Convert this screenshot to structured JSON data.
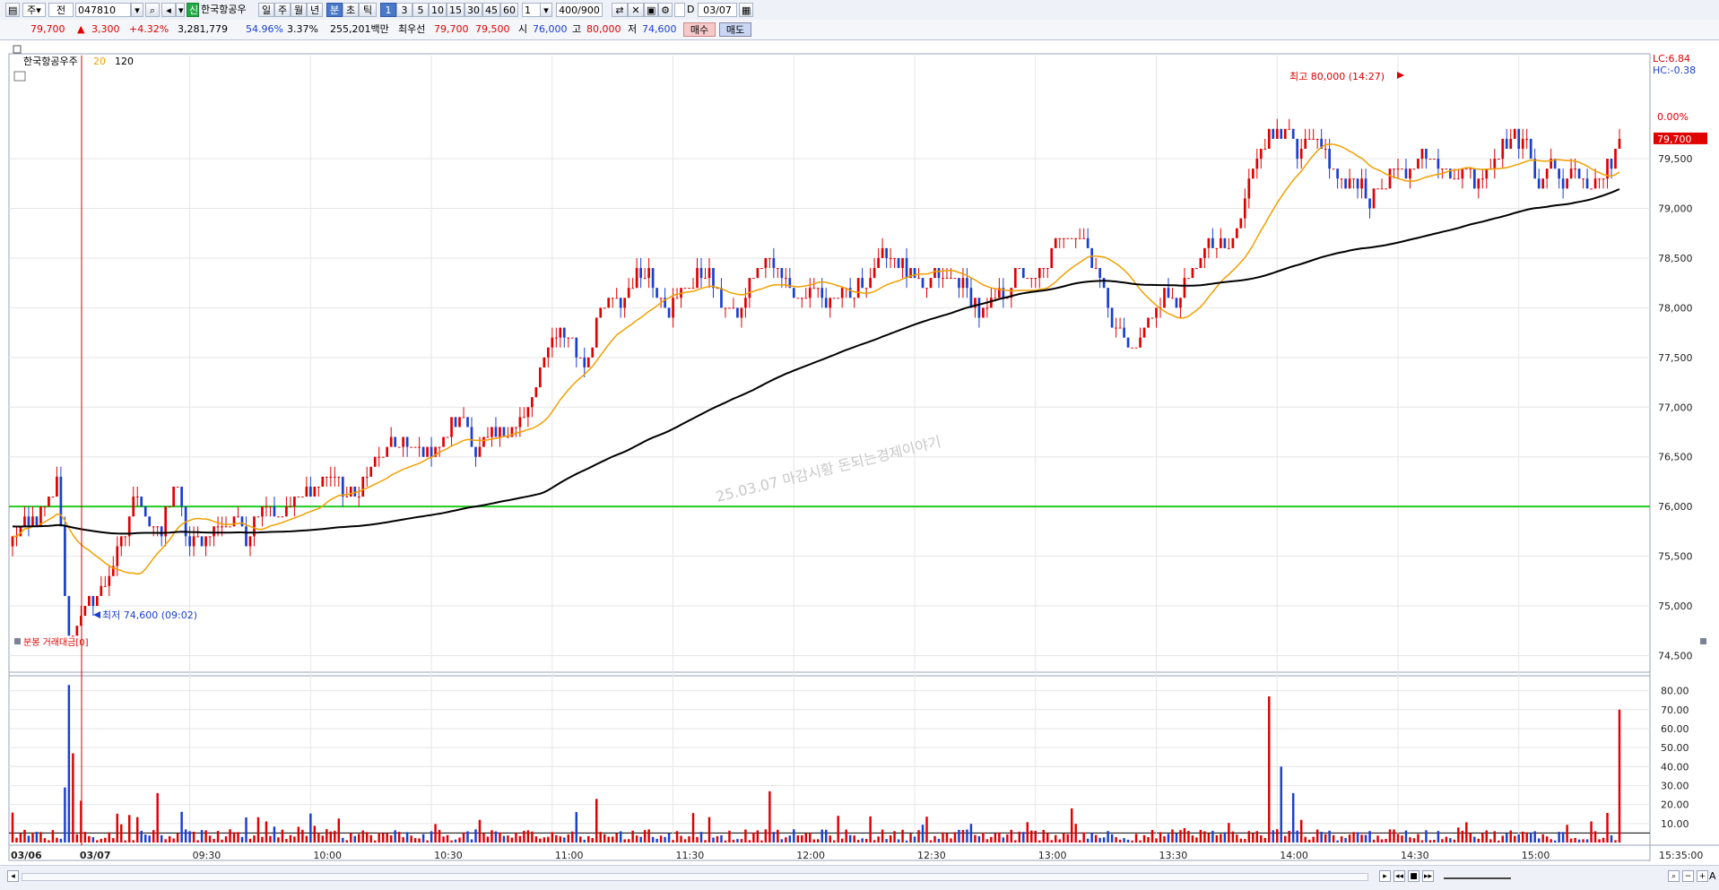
{
  "toolbar": {
    "market": "주",
    "scope": "전",
    "code": "047810",
    "name_tag": "신",
    "stock_name": "한국항공우",
    "periods": [
      "일",
      "주",
      "월",
      "년",
      "분",
      "초",
      "틱"
    ],
    "active_period": "분",
    "intervals": [
      "1",
      "3",
      "5",
      "10",
      "15",
      "30",
      "45",
      "60"
    ],
    "active_interval": "1",
    "count_select": "1",
    "range": "400/900",
    "d_label": "D",
    "date": "03/07"
  },
  "quote": {
    "price": "79,700",
    "arrow": "▲",
    "change": "3,300",
    "change_pct": "+4.32%",
    "volume": "3,281,779",
    "ratio1": "54.96%",
    "ratio2": "3.37%",
    "amount": "255,201백만",
    "best_label": "최우선",
    "best_ask": "79,700",
    "best_bid": "79,500",
    "open_label": "시",
    "open": "76,000",
    "high_label": "고",
    "high": "80,000",
    "low_label": "저",
    "low": "74,600",
    "buy_label": "매수",
    "sell_label": "매도"
  },
  "colors": {
    "up": "#e00000",
    "down": "#1a3fd0",
    "ma20": "#f0a000",
    "ma120": "#000000",
    "baseline": "#22cc22"
  },
  "chart_data": [
    {
      "type": "candlestick",
      "title": "한국항공우주",
      "legend": [
        {
          "name": "20",
          "color": "#f0a000"
        },
        {
          "name": "120",
          "color": "#000000"
        }
      ],
      "y_ticks": [
        "74,500",
        "75,000",
        "75,500",
        "76,000",
        "76,500",
        "77,000",
        "77,500",
        "78,000",
        "78,500",
        "79,000",
        "79,500"
      ],
      "ylim": [
        74450,
        80150
      ],
      "x_ticks": [
        "03/06",
        "03/07",
        "09:30",
        "10:00",
        "10:30",
        "11:00",
        "11:30",
        "12:00",
        "12:30",
        "13:00",
        "13:30",
        "14:00",
        "14:30",
        "15:00",
        "15:35:00"
      ],
      "last_price_label": "79,700",
      "last_pct_label": "0.00%",
      "lc_label": "LC:6.84",
      "hc_label": "HC:-0.38",
      "high_note": "최고 80,000 (14:27)",
      "low_note": "최저 74,600 (09:02)",
      "watermark": "25.03.07 마감시황 돈되는경제이야기",
      "baseline_value": 76000,
      "path": [
        [
          0,
          75650
        ],
        [
          6,
          75900
        ],
        [
          10,
          76050
        ],
        [
          11,
          76350
        ],
        [
          13,
          75100
        ],
        [
          14,
          74650
        ],
        [
          17,
          74900
        ],
        [
          20,
          75050
        ],
        [
          24,
          75300
        ],
        [
          27,
          75600
        ],
        [
          31,
          76150
        ],
        [
          34,
          75800
        ],
        [
          37,
          75750
        ],
        [
          40,
          76250
        ],
        [
          42,
          75950
        ],
        [
          44,
          75600
        ],
        [
          47,
          75650
        ],
        [
          50,
          75750
        ],
        [
          53,
          75850
        ],
        [
          56,
          75900
        ],
        [
          58,
          75600
        ],
        [
          60,
          75950
        ],
        [
          63,
          76050
        ],
        [
          66,
          75950
        ],
        [
          70,
          76050
        ],
        [
          73,
          76150
        ],
        [
          76,
          76200
        ],
        [
          79,
          76350
        ],
        [
          82,
          76150
        ],
        [
          85,
          76100
        ],
        [
          88,
          76300
        ],
        [
          91,
          76500
        ],
        [
          94,
          76600
        ],
        [
          97,
          76650
        ],
        [
          100,
          76550
        ],
        [
          103,
          76500
        ],
        [
          106,
          76650
        ],
        [
          109,
          76800
        ],
        [
          112,
          76950
        ],
        [
          115,
          76550
        ],
        [
          118,
          76700
        ],
        [
          121,
          76750
        ],
        [
          124,
          76800
        ],
        [
          127,
          76900
        ],
        [
          130,
          77150
        ],
        [
          133,
          77650
        ],
        [
          136,
          77800
        ],
        [
          139,
          77650
        ],
        [
          142,
          77400
        ],
        [
          145,
          77850
        ],
        [
          148,
          78050
        ],
        [
          151,
          78000
        ],
        [
          154,
          78300
        ],
        [
          157,
          78400
        ],
        [
          160,
          78200
        ],
        [
          163,
          78000
        ],
        [
          166,
          78150
        ],
        [
          169,
          78250
        ],
        [
          172,
          78400
        ],
        [
          175,
          78100
        ],
        [
          178,
          77950
        ],
        [
          181,
          78000
        ],
        [
          184,
          78300
        ],
        [
          187,
          78450
        ],
        [
          190,
          78400
        ],
        [
          193,
          78250
        ],
        [
          196,
          78100
        ],
        [
          199,
          78200
        ],
        [
          202,
          78050
        ],
        [
          205,
          78150
        ],
        [
          208,
          78100
        ],
        [
          211,
          78250
        ],
        [
          214,
          78400
        ],
        [
          217,
          78550
        ],
        [
          220,
          78450
        ],
        [
          223,
          78300
        ],
        [
          226,
          78200
        ],
        [
          229,
          78350
        ],
        [
          232,
          78250
        ],
        [
          235,
          78300
        ],
        [
          238,
          78100
        ],
        [
          241,
          77900
        ],
        [
          244,
          78050
        ],
        [
          247,
          78200
        ],
        [
          250,
          78350
        ],
        [
          253,
          78250
        ],
        [
          256,
          78400
        ],
        [
          259,
          78600
        ],
        [
          262,
          78800
        ],
        [
          265,
          78750
        ],
        [
          268,
          78500
        ],
        [
          271,
          78150
        ],
        [
          274,
          77800
        ],
        [
          277,
          77600
        ],
        [
          280,
          77700
        ],
        [
          283,
          77900
        ],
        [
          286,
          78150
        ],
        [
          289,
          78050
        ],
        [
          292,
          78300
        ],
        [
          295,
          78500
        ],
        [
          298,
          78650
        ],
        [
          301,
          78550
        ],
        [
          304,
          78750
        ],
        [
          307,
          79300
        ],
        [
          310,
          79650
        ],
        [
          313,
          79750
        ],
        [
          316,
          79850
        ],
        [
          319,
          79500
        ],
        [
          322,
          79700
        ],
        [
          325,
          79600
        ],
        [
          328,
          79400
        ],
        [
          331,
          79200
        ],
        [
          334,
          79300
        ],
        [
          337,
          79100
        ],
        [
          340,
          79250
        ],
        [
          343,
          79400
        ],
        [
          346,
          79300
        ],
        [
          349,
          79500
        ],
        [
          352,
          79550
        ],
        [
          355,
          79300
        ],
        [
          358,
          79400
        ],
        [
          361,
          79350
        ],
        [
          364,
          79300
        ],
        [
          367,
          79500
        ],
        [
          370,
          79600
        ],
        [
          373,
          79700
        ],
        [
          376,
          79650
        ],
        [
          379,
          79300
        ],
        [
          382,
          79400
        ],
        [
          385,
          79250
        ],
        [
          388,
          79450
        ],
        [
          391,
          79200
        ],
        [
          394,
          79350
        ],
        [
          397,
          79500
        ],
        [
          400,
          79700
        ]
      ],
      "volume_panel": {
        "title": "분봉 거래대금[0]",
        "y_ticks": [
          "10.00",
          "20.00",
          "30.00",
          "40.00",
          "50.00",
          "60.00",
          "70.00",
          "80.00"
        ],
        "ylim": [
          0,
          85
        ],
        "reference_level": 5,
        "spikes": [
          {
            "bar": 14,
            "value": 83
          },
          {
            "bar": 15,
            "value": 47
          },
          {
            "bar": 13,
            "value": 29
          },
          {
            "bar": 17,
            "value": 22
          },
          {
            "bar": 36,
            "value": 26
          },
          {
            "bar": 145,
            "value": 23
          },
          {
            "bar": 188,
            "value": 27
          },
          {
            "bar": 312,
            "value": 77
          },
          {
            "bar": 315,
            "value": 40
          },
          {
            "bar": 318,
            "value": 26
          },
          {
            "bar": 399,
            "value": 70
          }
        ]
      }
    }
  ],
  "statusbar": {
    "icons": [
      "scroll-left-icon",
      "rewind-icon",
      "prev-icon",
      "stop-icon",
      "next-icon",
      "zoom-icon",
      "minus-icon",
      "plus-icon",
      "font-a-icon"
    ],
    "font_label": "A"
  }
}
